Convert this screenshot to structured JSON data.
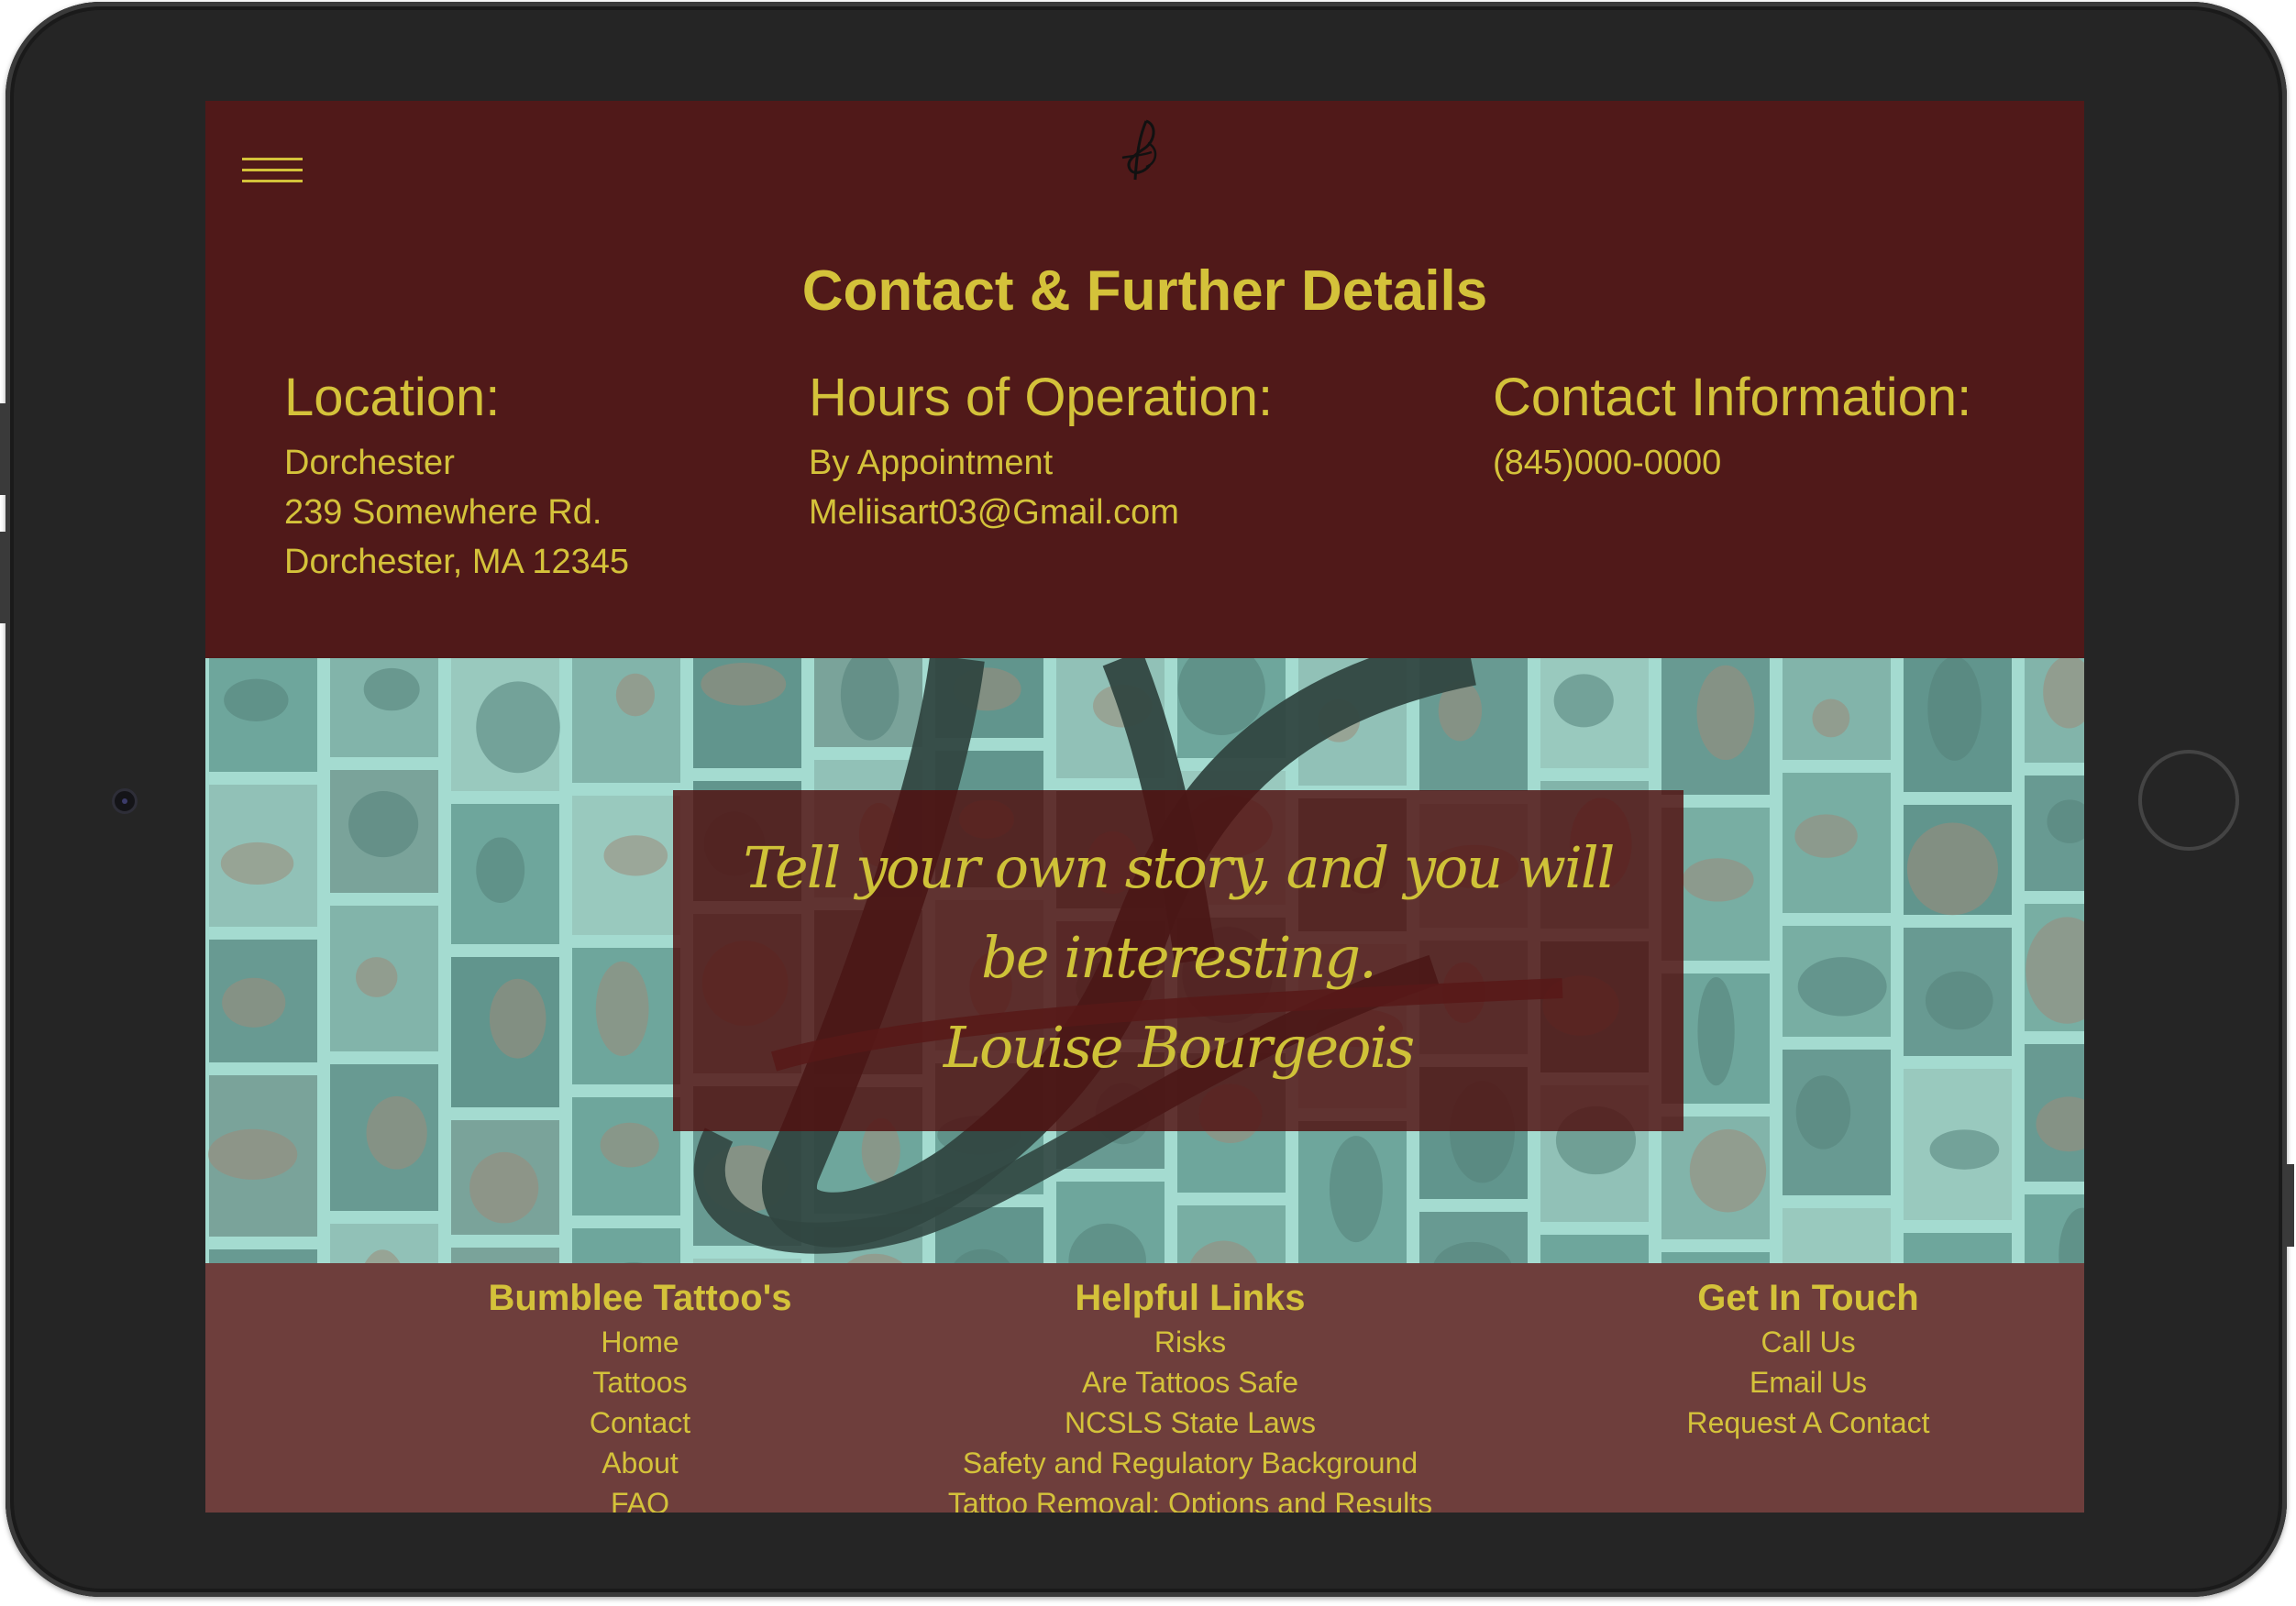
{
  "header": {
    "title": "Contact & Further Details"
  },
  "info": {
    "location": {
      "heading": "Location:",
      "lines": [
        "Dorchester",
        "239 Somewhere Rd.",
        "Dorchester, MA 12345"
      ]
    },
    "hours": {
      "heading": "Hours of Operation:",
      "lines": [
        "By Appointment",
        "Meliisart03@Gmail.com"
      ]
    },
    "contact": {
      "heading": "Contact Information:",
      "lines": [
        "(845)000-0000"
      ]
    }
  },
  "hero": {
    "quote": "Tell your own story, and you will be interesting.",
    "author": "Louise Bourgeois"
  },
  "footer": {
    "brand": {
      "heading": "Bumblee Tattoo's",
      "links": [
        "Home",
        "Tattoos",
        "Contact",
        "About",
        "FAQ"
      ]
    },
    "helpful": {
      "heading": "Helpful Links",
      "links": [
        "Risks",
        "Are Tattoos Safe",
        "NCSLS State Laws",
        "Safety and Regulatory Background",
        "Tattoo Removal: Options and Results"
      ]
    },
    "touch": {
      "heading": "Get In Touch",
      "links": [
        "Call Us",
        "Email Us",
        "Request A Contact"
      ]
    }
  },
  "colors": {
    "header_bg": "#501919",
    "accent_text": "#d4c23a",
    "footer_bg": "#6e3e3c",
    "quote_box": "#500e0e"
  },
  "icons": {
    "menu": "hamburger-menu-icon",
    "logo": "butterfly-logo-icon"
  }
}
